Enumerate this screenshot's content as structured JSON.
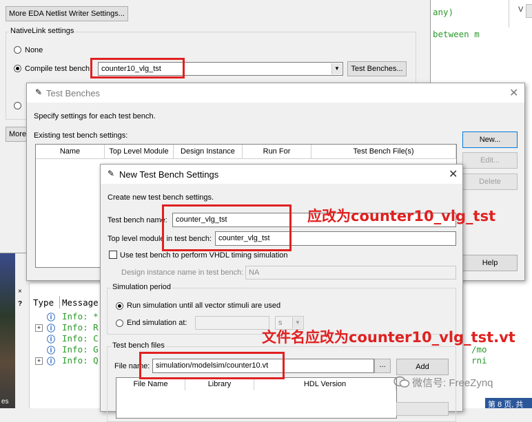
{
  "background": {
    "code_line1": "any)",
    "code_line2": "between m",
    "code_right1": "/mo",
    "code_right2": "rni",
    "page_status": "第 8 页, 共",
    "messages": {
      "col_type": "Type",
      "col_message": "Message",
      "lines": [
        "Info: *",
        "Info: R",
        "Info: C",
        "Info: G",
        "Info: Q"
      ]
    },
    "side_label": "es"
  },
  "settings": {
    "more_eda_button": "More EDA Netlist Writer Settings...",
    "nativelink_title": "NativeLink settings",
    "none_label": "None",
    "compile_label": "Compile test bench:",
    "compile_value": "counter10_vlg_tst",
    "test_benches_button": "Test Benches...",
    "more_button": "More"
  },
  "test_benches": {
    "title": "Test Benches",
    "description": "Specify settings for each test bench.",
    "existing_label": "Existing test bench settings:",
    "columns": [
      "Name",
      "Top Level Module",
      "Design Instance",
      "Run For",
      "Test Bench File(s)"
    ],
    "new_button": "New...",
    "edit_button": "Edit...",
    "delete_button": "Delete",
    "help_button": "Help"
  },
  "new_settings": {
    "title": "New Test Bench Settings",
    "description": "Create new test bench settings.",
    "name_label": "Test bench name:",
    "name_value": "counter_vlg_tst",
    "top_label": "Top level module in test bench:",
    "top_value": "counter_vlg_tst",
    "vhdl_check_label": "Use test bench to perform VHDL timing simulation",
    "design_instance_label": "Design instance name in test bench:",
    "design_instance_value": "NA",
    "sim_period_title": "Simulation period",
    "run_all_label": "Run simulation until all vector stimuli are used",
    "end_at_label": "End simulation at:",
    "end_unit": "s",
    "files_title": "Test bench files",
    "file_name_label": "File name:",
    "file_name_value": "simulation/modelsim/counter10.vt",
    "browse_button": "...",
    "add_button": "Add",
    "file_columns": [
      "File Name",
      "Library",
      "HDL Version"
    ]
  },
  "annotations": {
    "name_hint": "应改为counter10_vlg_tst",
    "file_hint": "文件名应改为counter10_vlg_tst.vt"
  },
  "watermark": "微信号: FreeZynq",
  "colors": {
    "annotation": "#e02020",
    "info_green": "#2a9a2a"
  }
}
